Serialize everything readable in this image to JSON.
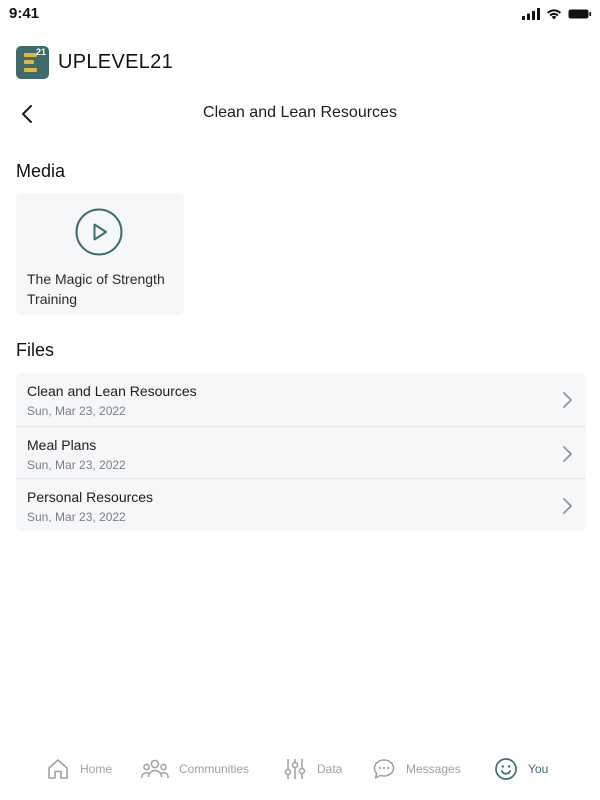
{
  "status_bar": {
    "time": "9:41"
  },
  "brand": {
    "logo_sup": "21",
    "name": "UPLEVEL21"
  },
  "header": {
    "title": "Clean and Lean Resources"
  },
  "media": {
    "section_title": "Media",
    "items": [
      {
        "title": "The Magic of Strength Training",
        "icon": "play-icon"
      }
    ]
  },
  "files": {
    "section_title": "Files",
    "items": [
      {
        "name": "Clean and Lean Resources",
        "date": "Sun, Mar 23, 2022"
      },
      {
        "name": "Meal Plans",
        "date": "Sun, Mar 23, 2022"
      },
      {
        "name": "Personal Resources",
        "date": "Sun, Mar 23, 2022"
      }
    ]
  },
  "tab_bar": {
    "items": [
      {
        "label": "Home",
        "icon": "home-icon"
      },
      {
        "label": "Communities",
        "icon": "people-icon"
      },
      {
        "label": "Data",
        "icon": "sliders-icon"
      },
      {
        "label": "Messages",
        "icon": "chat-icon"
      },
      {
        "label": "You",
        "icon": "smile-icon",
        "active": true
      }
    ]
  },
  "colors": {
    "brand_teal": "#3e6b6c",
    "brand_yellow": "#e5b53f",
    "card_background": "#f6f7f8",
    "tab_inactive": "#9ba1a6"
  }
}
